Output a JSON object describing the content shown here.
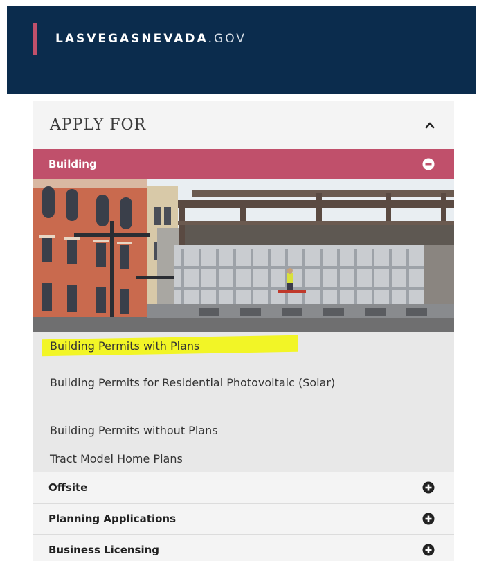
{
  "header": {
    "logo_bold": "LASVEGASNEVADA",
    "logo_light": ".GOV",
    "bg_color": "#0b2c4d",
    "accent_color": "#c0506b"
  },
  "apply": {
    "title": "APPLY FOR",
    "toggle_icon": "chevron-up-icon"
  },
  "building": {
    "label": "Building",
    "toggle_icon": "minus-circle-icon",
    "bg_color": "#c0506b",
    "image_alt": "Building under construction next to ornate building facade",
    "items": [
      "Building Permits with Plans",
      "Building Permits for Residential Photovoltaic (Solar)",
      "Building Permits without Plans",
      "Tract Model Home Plans"
    ]
  },
  "accordion": [
    {
      "label": "Offsite",
      "icon": "plus-circle-icon"
    },
    {
      "label": "Planning Applications",
      "icon": "plus-circle-icon"
    },
    {
      "label": "Business Licensing",
      "icon": "plus-circle-icon"
    }
  ]
}
